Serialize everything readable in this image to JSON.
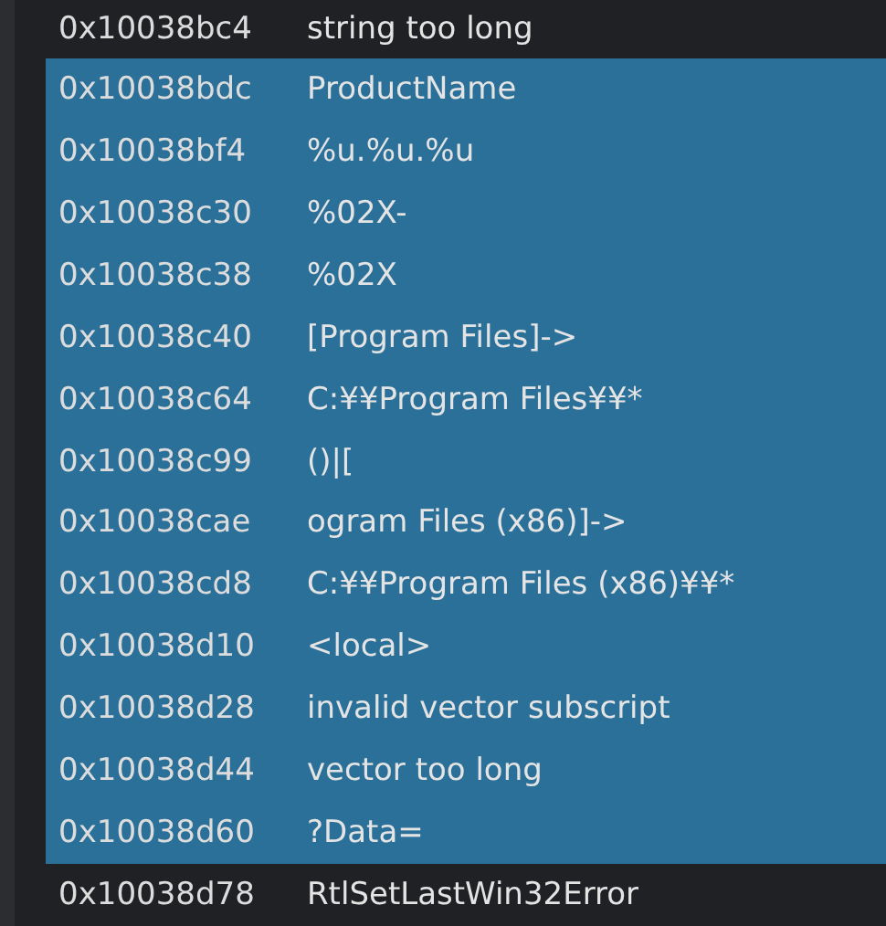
{
  "rows": [
    {
      "address": "0x10038bc4",
      "string": "string too long",
      "selected": false
    },
    {
      "address": "0x10038bdc",
      "string": "ProductName",
      "selected": true
    },
    {
      "address": "0x10038bf4",
      "string": "%u.%u.%u",
      "selected": true
    },
    {
      "address": "0x10038c30",
      "string": "%02X-",
      "selected": true
    },
    {
      "address": "0x10038c38",
      "string": "%02X",
      "selected": true
    },
    {
      "address": "0x10038c40",
      "string": "[Program Files]->",
      "selected": true
    },
    {
      "address": "0x10038c64",
      "string": "C:¥¥Program Files¥¥*",
      "selected": true
    },
    {
      "address": "0x10038c99",
      "string": "()|[",
      "selected": true
    },
    {
      "address": "0x10038cae",
      "string": "ogram Files (x86)]->",
      "selected": true
    },
    {
      "address": "0x10038cd8",
      "string": "C:¥¥Program Files (x86)¥¥*",
      "selected": true
    },
    {
      "address": "0x10038d10",
      "string": "<local>",
      "selected": true
    },
    {
      "address": "0x10038d28",
      "string": "invalid vector subscript",
      "selected": true
    },
    {
      "address": "0x10038d44",
      "string": "vector too long",
      "selected": true
    },
    {
      "address": "0x10038d60",
      "string": "?Data=",
      "selected": true
    },
    {
      "address": "0x10038d78",
      "string": "RtlSetLastWin32Error",
      "selected": false
    }
  ]
}
